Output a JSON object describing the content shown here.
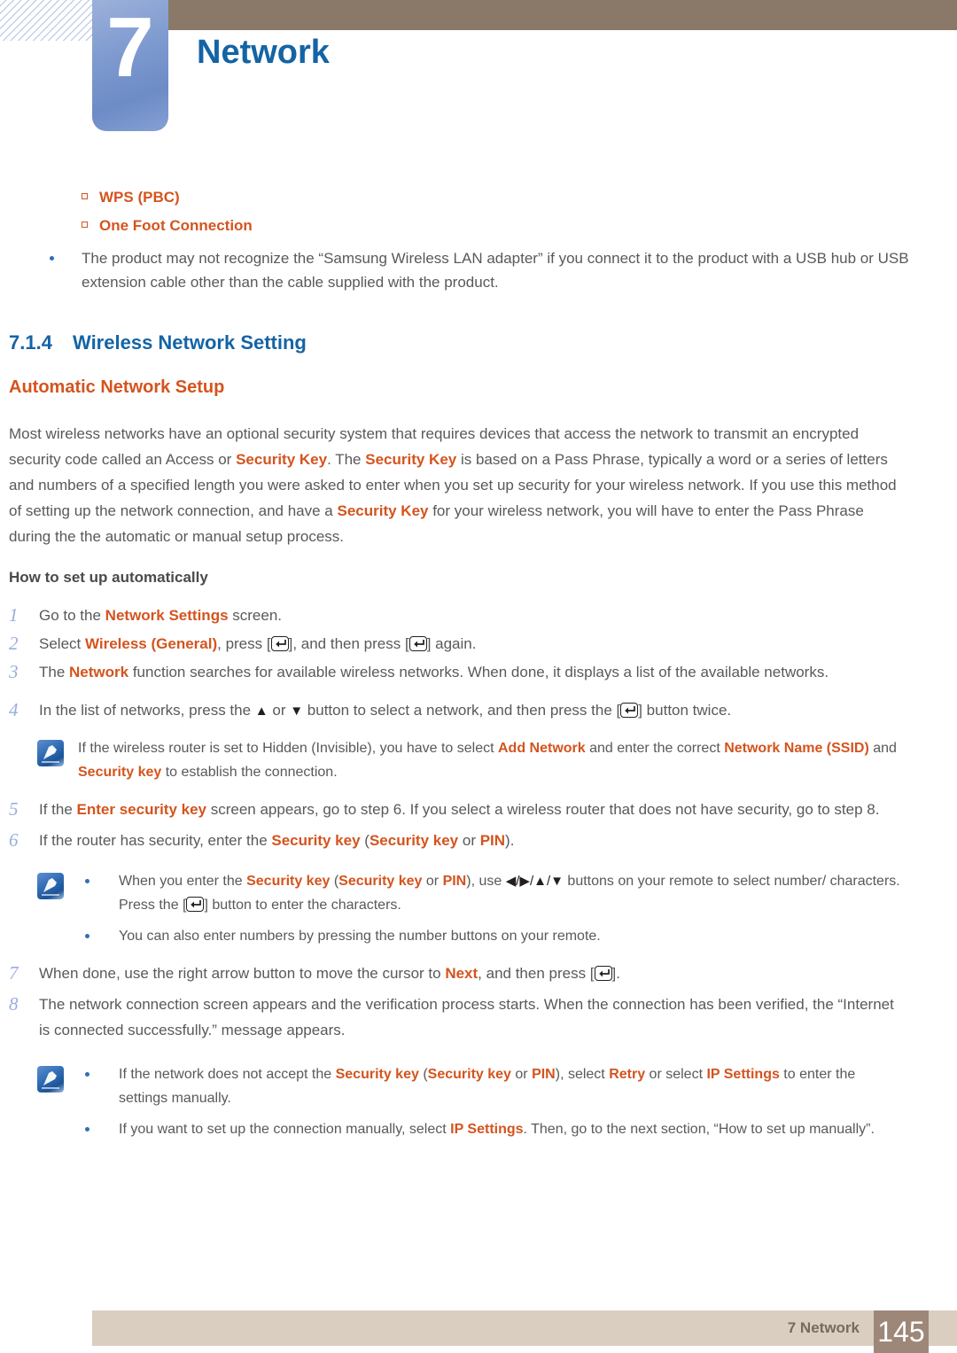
{
  "header": {
    "chapter_number": "7",
    "chapter_title": "Network",
    "accent_blue": "#1464a5",
    "bar_brown": "#8a7968"
  },
  "top_notes": {
    "sub_items": [
      {
        "label": "WPS (PBC)"
      },
      {
        "label": "One Foot Connection"
      }
    ],
    "bullets": [
      {
        "text": "The product may not recognize the “Samsung Wireless LAN adapter” if you connect it to the product with a USB hub or USB extension cable other than the cable supplied with the product."
      }
    ]
  },
  "section": {
    "number": "7.1.4",
    "title": "Wireless Network Setting",
    "sub_heading": "Automatic Network Setup",
    "intro_parts": [
      {
        "t": "Most wireless networks have an optional security system that requires devices that access the network to transmit an encrypted security code called an Access or ",
        "s": "plain"
      },
      {
        "t": "Security Key",
        "s": "orange"
      },
      {
        "t": ". The ",
        "s": "plain"
      },
      {
        "t": "Security Key",
        "s": "orange"
      },
      {
        "t": " is based on a Pass Phrase, typically a word or a series of letters and numbers of a specified length you were asked to enter when you set up security for your wireless network. If you use this method of setting up the network connection, and have a ",
        "s": "plain"
      },
      {
        "t": "Security Key",
        "s": "orange"
      },
      {
        "t": " for your wireless network, you will have to enter the Pass Phrase during the the automatic or manual setup process.",
        "s": "plain"
      }
    ],
    "how_to_label": "How to set up automatically"
  },
  "steps": [
    {
      "num": "1",
      "parts": [
        {
          "t": "Go to the ",
          "s": "plain"
        },
        {
          "t": "Network Settings",
          "s": "orange"
        },
        {
          "t": " screen.",
          "s": "plain"
        }
      ]
    },
    {
      "num": "2",
      "parts": [
        {
          "t": "Select ",
          "s": "plain"
        },
        {
          "t": "Wireless (General)",
          "s": "orange"
        },
        {
          "t": ", press [",
          "s": "plain"
        },
        {
          "t": "enter-key",
          "s": "key"
        },
        {
          "t": "], and then press [",
          "s": "plain"
        },
        {
          "t": "enter-key",
          "s": "key"
        },
        {
          "t": "] again.",
          "s": "plain"
        }
      ]
    },
    {
      "num": "3",
      "parts": [
        {
          "t": "The ",
          "s": "plain"
        },
        {
          "t": "Network",
          "s": "orange"
        },
        {
          "t": " function searches for available wireless networks. When done, it displays a list of the available networks.",
          "s": "plain"
        }
      ]
    },
    {
      "num": "4",
      "parts": [
        {
          "t": "In the list of networks, press the ",
          "s": "plain"
        },
        {
          "t": "▲",
          "s": "tri"
        },
        {
          "t": " or ",
          "s": "plain"
        },
        {
          "t": "▼",
          "s": "tri"
        },
        {
          "t": " button to select a network, and then press the [",
          "s": "plain"
        },
        {
          "t": "enter-key",
          "s": "key"
        },
        {
          "t": "] button twice.",
          "s": "plain"
        }
      ]
    },
    {
      "num": "5",
      "parts": [
        {
          "t": "If the ",
          "s": "plain"
        },
        {
          "t": "Enter security key",
          "s": "orange"
        },
        {
          "t": " screen appears, go to step 6. If you select a wireless router that does not have security, go to step 8.",
          "s": "plain"
        }
      ]
    },
    {
      "num": "6",
      "parts": [
        {
          "t": "If the router has security, enter the ",
          "s": "plain"
        },
        {
          "t": "Security key",
          "s": "orange"
        },
        {
          "t": " (",
          "s": "plain"
        },
        {
          "t": "Security key",
          "s": "orange"
        },
        {
          "t": " or ",
          "s": "plain"
        },
        {
          "t": "PIN",
          "s": "orange"
        },
        {
          "t": ").",
          "s": "plain"
        }
      ]
    },
    {
      "num": "7",
      "parts": [
        {
          "t": "When done, use the right arrow button to move the cursor to ",
          "s": "plain"
        },
        {
          "t": "Next",
          "s": "orange"
        },
        {
          "t": ", and then press [",
          "s": "plain"
        },
        {
          "t": "enter-key",
          "s": "key"
        },
        {
          "t": "].",
          "s": "plain"
        }
      ]
    },
    {
      "num": "8",
      "parts": [
        {
          "t": "The network connection screen appears and the verification process starts. When the connection has been verified, the “Internet is connected successfully.” message appears.",
          "s": "plain"
        }
      ]
    }
  ],
  "notes": [
    {
      "id": "note-after-step-4",
      "icon": "note-pencil-icon",
      "lines": [
        {
          "bulleted": false,
          "parts": [
            {
              "t": "If the wireless router is set to Hidden (Invisible), you have to select ",
              "s": "plain"
            },
            {
              "t": "Add Network",
              "s": "orange"
            },
            {
              "t": " and enter the correct ",
              "s": "plain"
            },
            {
              "t": "Network Name (SSID)",
              "s": "orange"
            },
            {
              "t": " and ",
              "s": "plain"
            },
            {
              "t": "Security key",
              "s": "orange"
            },
            {
              "t": " to establish the connection.",
              "s": "plain"
            }
          ]
        }
      ]
    },
    {
      "id": "note-after-step-6",
      "icon": "note-pencil-icon",
      "lines": [
        {
          "bulleted": true,
          "parts": [
            {
              "t": "When you enter the ",
              "s": "plain"
            },
            {
              "t": "Security key",
              "s": "orange"
            },
            {
              "t": " (",
              "s": "plain"
            },
            {
              "t": "Security key",
              "s": "orange"
            },
            {
              "t": " or ",
              "s": "plain"
            },
            {
              "t": "PIN",
              "s": "orange"
            },
            {
              "t": "), use ",
              "s": "plain"
            },
            {
              "t": "◀/▶/▲/▼",
              "s": "tri"
            },
            {
              "t": " buttons on your remote to select number/ characters. Press the [",
              "s": "plain"
            },
            {
              "t": "enter-key",
              "s": "key"
            },
            {
              "t": "] button to enter the characters.",
              "s": "plain"
            }
          ]
        },
        {
          "bulleted": true,
          "parts": [
            {
              "t": "You can also enter numbers by pressing the number buttons on your remote.",
              "s": "plain"
            }
          ]
        }
      ]
    },
    {
      "id": "note-after-step-8",
      "icon": "note-pencil-icon",
      "lines": [
        {
          "bulleted": true,
          "parts": [
            {
              "t": "If the network does not accept the ",
              "s": "plain"
            },
            {
              "t": "Security key",
              "s": "orange"
            },
            {
              "t": " (",
              "s": "plain"
            },
            {
              "t": "Security key",
              "s": "orange"
            },
            {
              "t": " or ",
              "s": "plain"
            },
            {
              "t": "PIN",
              "s": "orange"
            },
            {
              "t": "), select ",
              "s": "plain"
            },
            {
              "t": "Retry",
              "s": "orange"
            },
            {
              "t": " or select ",
              "s": "plain"
            },
            {
              "t": "IP Settings",
              "s": "orange"
            },
            {
              "t": " to enter the settings manually.",
              "s": "plain"
            }
          ]
        },
        {
          "bulleted": true,
          "parts": [
            {
              "t": "If you want to set up the connection manually, select ",
              "s": "plain"
            },
            {
              "t": "IP Settings",
              "s": "orange"
            },
            {
              "t": ". Then, go to the next section, “How to set up manually”.",
              "s": "plain"
            }
          ]
        }
      ]
    }
  ],
  "footer": {
    "label": "7 Network",
    "page_number": "145",
    "bar_color": "#d9cec0",
    "page_box_color": "#9d8779"
  }
}
